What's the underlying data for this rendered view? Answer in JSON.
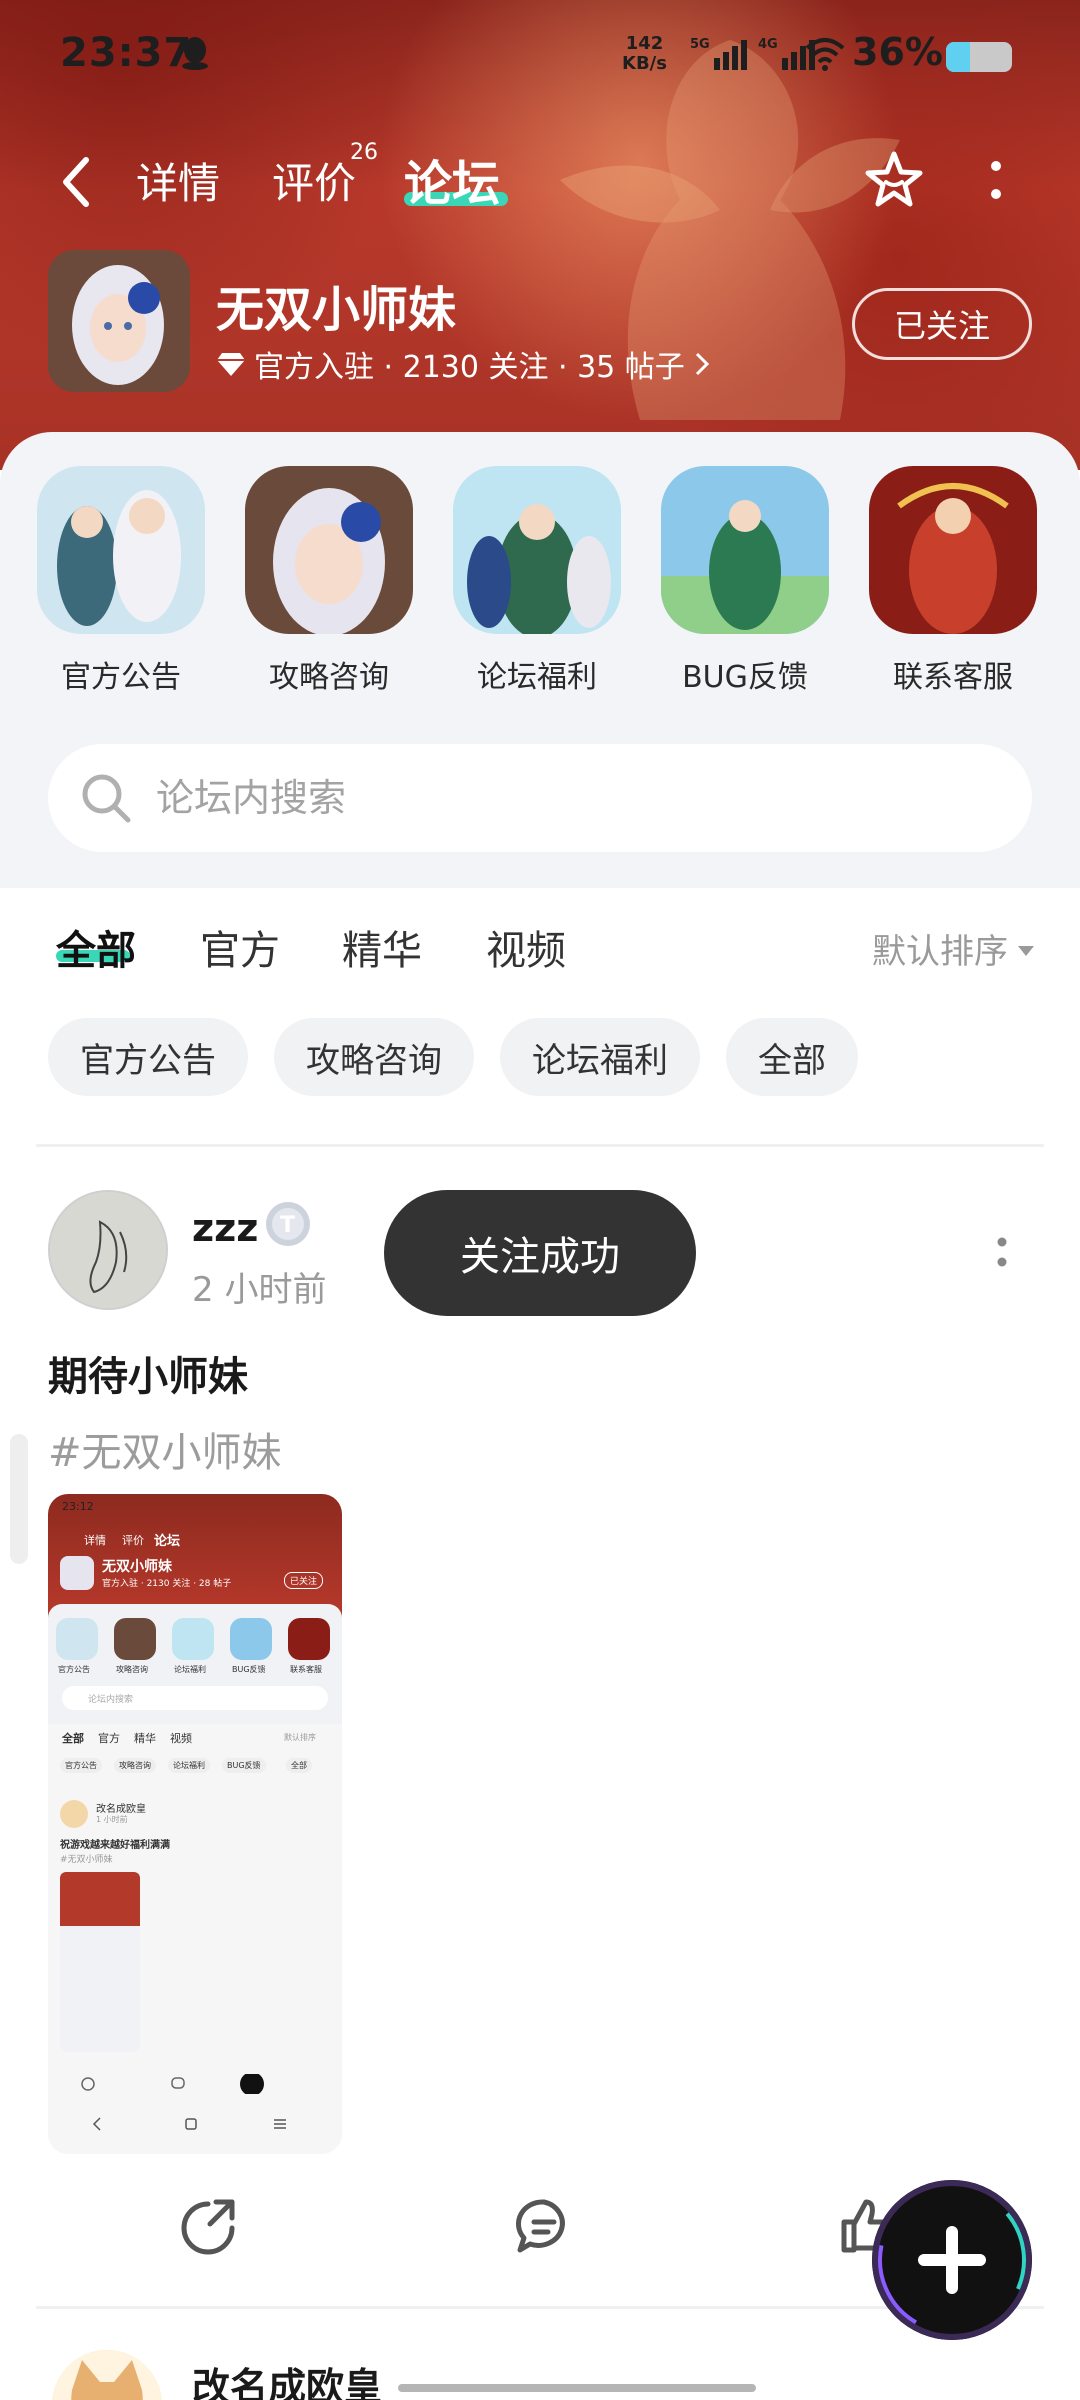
{
  "status_bar": {
    "time": "23:37",
    "net_speed_value": "142",
    "net_speed_unit": "KB/s",
    "sim1_label": "5G",
    "sim2_label": "4G",
    "battery_percent": "36%",
    "battery_level": 0.36,
    "accent_battery": "#5fd0f0"
  },
  "nav": {
    "detail_tab": "详情",
    "review_tab": "评价",
    "review_count": "26",
    "forum_tab": "论坛",
    "active_color": "#3ad6b8"
  },
  "game": {
    "name": "无双小师妹",
    "meta": "官方入驻 · 2130 关注 · 35 帖子",
    "follow_button": "已关注"
  },
  "categories": [
    {
      "label": "官方公告",
      "icon": "announcement-art"
    },
    {
      "label": "攻略咨询",
      "icon": "strategy-art"
    },
    {
      "label": "论坛福利",
      "icon": "welfare-art"
    },
    {
      "label": "BUG反馈",
      "icon": "bug-art"
    },
    {
      "label": "联系客服",
      "icon": "support-art"
    }
  ],
  "search": {
    "placeholder": "论坛内搜索"
  },
  "filter_tabs": [
    {
      "label": "全部",
      "active": true
    },
    {
      "label": "官方",
      "active": false
    },
    {
      "label": "精华",
      "active": false
    },
    {
      "label": "视频",
      "active": false
    }
  ],
  "sort_label": "默认排序",
  "chips": [
    "官方公告",
    "攻略咨询",
    "论坛福利",
    "全部"
  ],
  "post": {
    "username": "zzz",
    "time": "2 小时前",
    "toast": "关注成功",
    "title": "期待小师妹",
    "tag": "#无双小师妹"
  },
  "screenshot_thumb": {
    "time": "23:12",
    "tab1": "详情",
    "tab2": "评价",
    "tab3": "论坛",
    "game_name": "无双小师妹",
    "game_meta": "官方入驻 · 2130 关注 · 28 帖子",
    "follow": "已关注",
    "cats": [
      "官方公告",
      "攻略咨询",
      "论坛福利",
      "BUG反馈",
      "联系客服"
    ],
    "search": "论坛内搜索",
    "tabs": [
      "全部",
      "官方",
      "精华",
      "视频"
    ],
    "sort": "默认排序",
    "chips": [
      "官方公告",
      "攻略咨询",
      "论坛福利",
      "BUG反馈",
      "全部"
    ],
    "post_user": "改名成欧皇",
    "post_time": "1 小时前",
    "post_title": "祝游戏越来越好福利满满",
    "post_tag": "#无双小师妹"
  },
  "next_post": {
    "username": "改名成欧皇"
  },
  "icons": {
    "back": "chevron-left-icon",
    "favorite": "star-icon",
    "more": "more-vertical-icon",
    "share": "share-icon",
    "comment": "comment-icon",
    "like": "thumbs-up-icon",
    "create": "plus-icon"
  }
}
